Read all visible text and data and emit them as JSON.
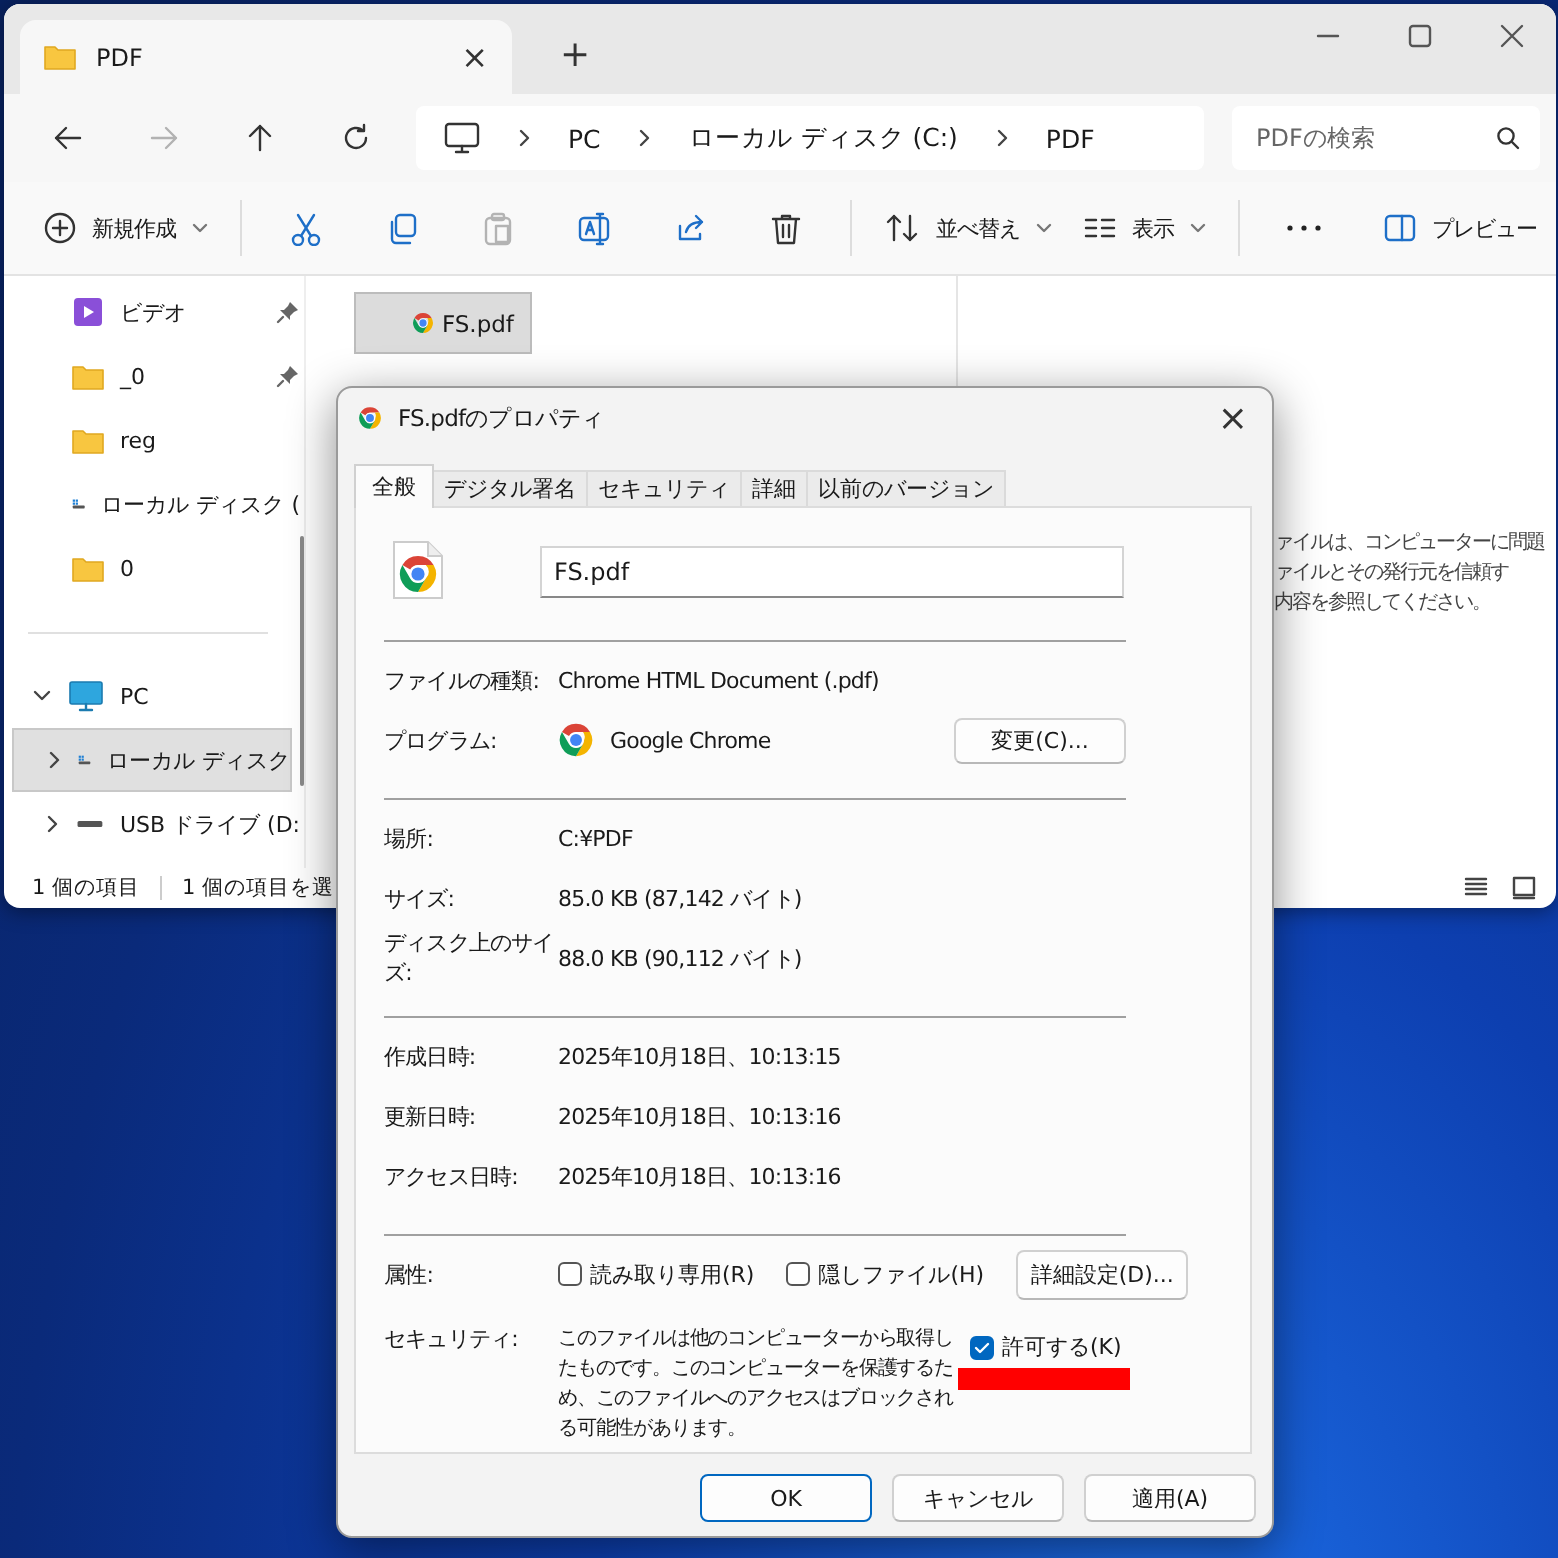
{
  "explorer": {
    "tabs": [
      {
        "label": "PDF",
        "selected": true,
        "close": "×"
      }
    ],
    "new_tab": "+",
    "nav_buttons": [
      {
        "disabled": false
      },
      {
        "disabled": true
      },
      {
        "disabled": false
      },
      {
        "disabled": false
      }
    ],
    "breadcrumb": [
      "PC",
      "ローカル ディスク (C:)",
      "PDF"
    ],
    "search": {
      "placeholder": "PDFの検索"
    },
    "new_menu": {
      "label": "新規作成"
    },
    "icon_buttons": [
      {
        "disabled": false
      },
      {
        "disabled": false
      },
      {
        "disabled": true
      },
      {
        "disabled": false
      },
      {
        "disabled": false
      },
      {
        "disabled": false
      }
    ],
    "sort_menu": {
      "label": "並べ替え"
    },
    "view_menu": {
      "label": "表示"
    },
    "preview_button": {
      "label": "プレビュー"
    },
    "quick_access": [
      {
        "label": "ビデオ",
        "kind": "video",
        "pinned": true,
        "selected": false
      },
      {
        "label": "_0",
        "kind": "folder",
        "pinned": true,
        "selected": false
      },
      {
        "label": "reg",
        "kind": "folder",
        "pinned": false,
        "selected": false
      },
      {
        "label": "ローカル ディスク (",
        "kind": "drive",
        "pinned": false,
        "selected": false
      },
      {
        "label": "0",
        "kind": "folder",
        "pinned": false,
        "selected": false
      }
    ],
    "this_pc": {
      "label": "PC",
      "expanded": true,
      "selected": false,
      "children": [
        {
          "label": "ローカル ディスク",
          "kind": "drive",
          "selected": true,
          "expanded": false
        },
        {
          "label": "USB ドライブ (D:",
          "kind": "usb",
          "selected": false,
          "expanded": false
        }
      ]
    },
    "files": [
      {
        "name": "FS.pdf",
        "selected": true
      }
    ],
    "preview_text": [
      "ァイルは、コンピューターに問題",
      "ァイルとその発行元を信頼す",
      "内容を参照してください。"
    ],
    "status_bar": {
      "item_count": "1 個の項目",
      "selection": "1 個の項目を選"
    }
  },
  "dialog": {
    "title": "FS.pdfのプロパティ",
    "close": "×",
    "tabs": [
      {
        "label": "全般",
        "selected": true
      },
      {
        "label": "デジタル署名",
        "selected": false
      },
      {
        "label": "セキュリティ",
        "selected": false
      },
      {
        "label": "詳細",
        "selected": false
      },
      {
        "label": "以前のバージョン",
        "selected": false
      }
    ],
    "file_name": "FS.pdf",
    "groups": [
      [
        {
          "label": "ファイルの種類:",
          "value": "Chrome HTML Document (.pdf)",
          "kind": "text"
        },
        {
          "label": "プログラム:",
          "value": "Google Chrome",
          "kind": "program",
          "button": "変更(C)..."
        }
      ],
      [
        {
          "label": "場所:",
          "value": "C:¥PDF",
          "kind": "text"
        },
        {
          "label": "サイズ:",
          "value": "85.0 KB (87,142 バイト)",
          "kind": "text"
        },
        {
          "label": "ディスク上のサイズ:",
          "value": "88.0 KB (90,112 バイト)",
          "kind": "text"
        }
      ],
      [
        {
          "label": "作成日時:",
          "value": "2025年10月18日、10:13:15",
          "kind": "text"
        },
        {
          "label": "更新日時:",
          "value": "2025年10月18日、10:13:16",
          "kind": "text"
        },
        {
          "label": "アクセス日時:",
          "value": "2025年10月18日、10:13:16",
          "kind": "text"
        }
      ]
    ],
    "attributes": {
      "label": "属性:",
      "checkboxes": [
        {
          "label": "読み取り専用(R)",
          "checked": false
        },
        {
          "label": "隠しファイル(H)",
          "checked": false
        }
      ],
      "button": "詳細設定(D)..."
    },
    "security": {
      "label": "セキュリティ:",
      "text": "このファイルは他のコンピューターから取得したものです。このコンピューターを保護するため、このファイルへのアクセスはブロックされる可能性があります。",
      "checkbox": {
        "label": "許可する(K)",
        "checked": true,
        "highlighted": true
      }
    },
    "buttons": [
      {
        "label": "OK",
        "default": true
      },
      {
        "label": "キャンセル",
        "default": false
      },
      {
        "label": "適用(A)",
        "default": false
      }
    ]
  }
}
